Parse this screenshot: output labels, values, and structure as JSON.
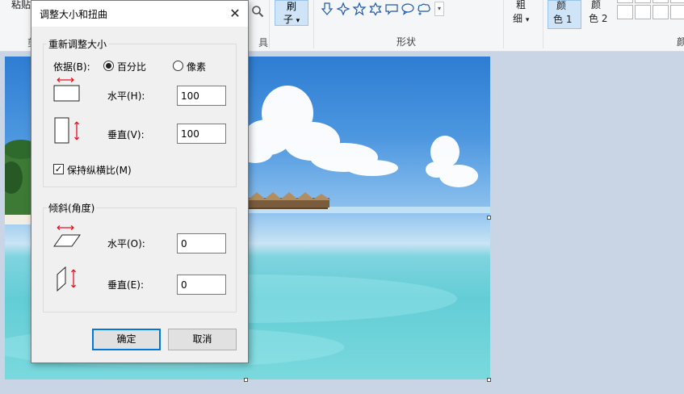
{
  "ribbon": {
    "paste_label": "粘贴",
    "clipboard_group_cut": "剪",
    "tools_group_cut": "具",
    "brush_label_top": "刷",
    "brush_label_bottom": "子",
    "shapes_group_label": "形状",
    "size_label_top": "粗",
    "size_label_bottom": "细",
    "color1_top": "颜",
    "color1_bottom": "色 1",
    "color2_top": "颜",
    "color2_bottom": "色 2",
    "edit_colors_cut": "颜",
    "dropdown_arrow": "▾"
  },
  "dialog": {
    "title": "调整大小和扭曲",
    "close_glyph": "✕",
    "resize": {
      "group_title": "重新调整大小",
      "by_label": "依据(B):",
      "option_percent": "百分比",
      "option_pixels": "像素",
      "selected": "percent",
      "horizontal_label": "水平(H):",
      "horizontal_value": "100",
      "vertical_label": "垂直(V):",
      "vertical_value": "100",
      "keep_ratio_label": "保持纵横比(M)",
      "keep_ratio_checked": true,
      "check_glyph": "✓"
    },
    "skew": {
      "group_title": "倾斜(角度)",
      "horizontal_label": "水平(O):",
      "horizontal_value": "0",
      "vertical_label": "垂直(E):",
      "vertical_value": "0"
    },
    "ok_label": "确定",
    "cancel_label": "取消"
  },
  "colors": {
    "accent_blue": "#0078d7",
    "arrow_red": "#e81123",
    "ribbon_selected": "#cfe4f7"
  }
}
